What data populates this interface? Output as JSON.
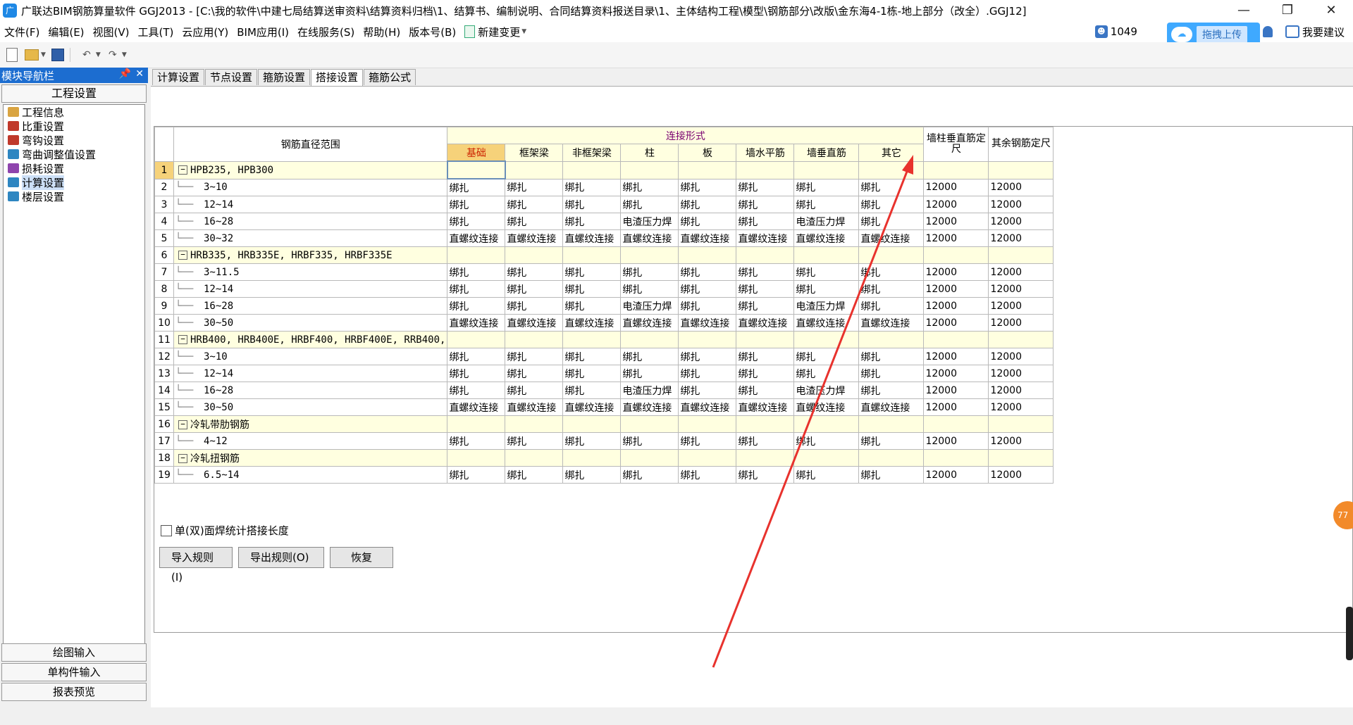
{
  "window": {
    "title": "广联达BIM钢筋算量软件 GGJ2013 - [C:\\我的软件\\中建七局结算送审资料\\结算资料归档\\1、结算书、编制说明、合同结算资料报送目录\\1、主体结构工程\\模型\\钢筋部分\\改版\\金东海4-1栋-地上部分（改全）.GGJ12]",
    "logo": "广",
    "minimize": "—",
    "restore": "❐",
    "close": "✕"
  },
  "menu": {
    "items": [
      "文件(F)",
      "编辑(E)",
      "视图(V)",
      "工具(T)",
      "云应用(Y)",
      "BIM应用(I)",
      "在线服务(S)",
      "帮助(H)",
      "版本号(B)"
    ],
    "new_change": "新建变更",
    "user_id": "1049",
    "upload": "拖拽上传",
    "suggest": "我要建议"
  },
  "nav": {
    "title": "模块导航栏",
    "pin": "ᵖ",
    "close": "✕",
    "section": "工程设置",
    "items": [
      {
        "label": "工程信息",
        "color": "#d9a441"
      },
      {
        "label": "比重设置",
        "color": "#c0392b"
      },
      {
        "label": "弯钩设置",
        "color": "#c0392b"
      },
      {
        "label": "弯曲调整值设置",
        "color": "#2e86c1"
      },
      {
        "label": "损耗设置",
        "color": "#8e44ad"
      },
      {
        "label": "计算设置",
        "color": "#2e86c1"
      },
      {
        "label": "楼层设置",
        "color": "#2e86c1"
      }
    ],
    "bottom": [
      "绘图输入",
      "单构件输入",
      "报表预览"
    ]
  },
  "tabs": [
    "计算设置",
    "节点设置",
    "箍筋设置",
    "搭接设置",
    "箍筋公式"
  ],
  "active_tab": 3,
  "grid": {
    "header_range": "钢筋直径范围",
    "header_group": "连接形式",
    "sub_headers": [
      "基础",
      "框架梁",
      "非框架梁",
      "柱",
      "板",
      "墙水平筋",
      "墙垂直筋",
      "其它"
    ],
    "header_wall": "墙柱垂直筋定尺",
    "header_other": "其余钢筋定尺",
    "rows": [
      {
        "n": "1",
        "name": "HPB235, HPB300",
        "group": true,
        "cells": [
          "",
          "",
          "",
          "",
          "",
          "",
          "",
          "",
          "",
          ""
        ]
      },
      {
        "n": "2",
        "name": "3~10",
        "group": false,
        "cells": [
          "绑扎",
          "绑扎",
          "绑扎",
          "绑扎",
          "绑扎",
          "绑扎",
          "绑扎",
          "绑扎",
          "12000",
          "12000"
        ]
      },
      {
        "n": "3",
        "name": "12~14",
        "group": false,
        "cells": [
          "绑扎",
          "绑扎",
          "绑扎",
          "绑扎",
          "绑扎",
          "绑扎",
          "绑扎",
          "绑扎",
          "12000",
          "12000"
        ]
      },
      {
        "n": "4",
        "name": "16~28",
        "group": false,
        "cells": [
          "绑扎",
          "绑扎",
          "绑扎",
          "电渣压力焊",
          "绑扎",
          "绑扎",
          "电渣压力焊",
          "绑扎",
          "12000",
          "12000"
        ]
      },
      {
        "n": "5",
        "name": "30~32",
        "group": false,
        "cells": [
          "直螺纹连接",
          "直螺纹连接",
          "直螺纹连接",
          "直螺纹连接",
          "直螺纹连接",
          "直螺纹连接",
          "直螺纹连接",
          "直螺纹连接",
          "12000",
          "12000"
        ]
      },
      {
        "n": "6",
        "name": "HRB335, HRB335E, HRBF335, HRBF335E",
        "group": true,
        "cells": [
          "",
          "",
          "",
          "",
          "",
          "",
          "",
          "",
          "",
          ""
        ]
      },
      {
        "n": "7",
        "name": "3~11.5",
        "group": false,
        "cells": [
          "绑扎",
          "绑扎",
          "绑扎",
          "绑扎",
          "绑扎",
          "绑扎",
          "绑扎",
          "绑扎",
          "12000",
          "12000"
        ]
      },
      {
        "n": "8",
        "name": "12~14",
        "group": false,
        "cells": [
          "绑扎",
          "绑扎",
          "绑扎",
          "绑扎",
          "绑扎",
          "绑扎",
          "绑扎",
          "绑扎",
          "12000",
          "12000"
        ]
      },
      {
        "n": "9",
        "name": "16~28",
        "group": false,
        "cells": [
          "绑扎",
          "绑扎",
          "绑扎",
          "电渣压力焊",
          "绑扎",
          "绑扎",
          "电渣压力焊",
          "绑扎",
          "12000",
          "12000"
        ]
      },
      {
        "n": "10",
        "name": "30~50",
        "group": false,
        "cells": [
          "直螺纹连接",
          "直螺纹连接",
          "直螺纹连接",
          "直螺纹连接",
          "直螺纹连接",
          "直螺纹连接",
          "直螺纹连接",
          "直螺纹连接",
          "12000",
          "12000"
        ]
      },
      {
        "n": "11",
        "name": "HRB400, HRB400E, HRBF400, HRBF400E, RRB400,",
        "group": true,
        "cells": [
          "",
          "",
          "",
          "",
          "",
          "",
          "",
          "",
          "",
          ""
        ]
      },
      {
        "n": "12",
        "name": "3~10",
        "group": false,
        "cells": [
          "绑扎",
          "绑扎",
          "绑扎",
          "绑扎",
          "绑扎",
          "绑扎",
          "绑扎",
          "绑扎",
          "12000",
          "12000"
        ]
      },
      {
        "n": "13",
        "name": "12~14",
        "group": false,
        "cells": [
          "绑扎",
          "绑扎",
          "绑扎",
          "绑扎",
          "绑扎",
          "绑扎",
          "绑扎",
          "绑扎",
          "12000",
          "12000"
        ]
      },
      {
        "n": "14",
        "name": "16~28",
        "group": false,
        "cells": [
          "绑扎",
          "绑扎",
          "绑扎",
          "电渣压力焊",
          "绑扎",
          "绑扎",
          "电渣压力焊",
          "绑扎",
          "12000",
          "12000"
        ]
      },
      {
        "n": "15",
        "name": "30~50",
        "group": false,
        "cells": [
          "直螺纹连接",
          "直螺纹连接",
          "直螺纹连接",
          "直螺纹连接",
          "直螺纹连接",
          "直螺纹连接",
          "直螺纹连接",
          "直螺纹连接",
          "12000",
          "12000"
        ]
      },
      {
        "n": "16",
        "name": "冷轧带肋钢筋",
        "group": true,
        "cells": [
          "",
          "",
          "",
          "",
          "",
          "",
          "",
          "",
          "",
          ""
        ]
      },
      {
        "n": "17",
        "name": "4~12",
        "group": false,
        "cells": [
          "绑扎",
          "绑扎",
          "绑扎",
          "绑扎",
          "绑扎",
          "绑扎",
          "绑扎",
          "绑扎",
          "12000",
          "12000"
        ]
      },
      {
        "n": "18",
        "name": "冷轧扭钢筋",
        "group": true,
        "cells": [
          "",
          "",
          "",
          "",
          "",
          "",
          "",
          "",
          "",
          ""
        ]
      },
      {
        "n": "19",
        "name": "6.5~14",
        "group": false,
        "cells": [
          "绑扎",
          "绑扎",
          "绑扎",
          "绑扎",
          "绑扎",
          "绑扎",
          "绑扎",
          "绑扎",
          "12000",
          "12000"
        ]
      }
    ]
  },
  "checkbox_label": "单(双)面焊统计搭接长度",
  "buttons": [
    "导入规则(I)",
    "导出规则(O)",
    "恢复"
  ],
  "side_bubble": "77",
  "colors": {
    "annotation_arrow": "#e8322d",
    "nav_header": "#1c6dd0",
    "group_row": "#ffffe0"
  }
}
